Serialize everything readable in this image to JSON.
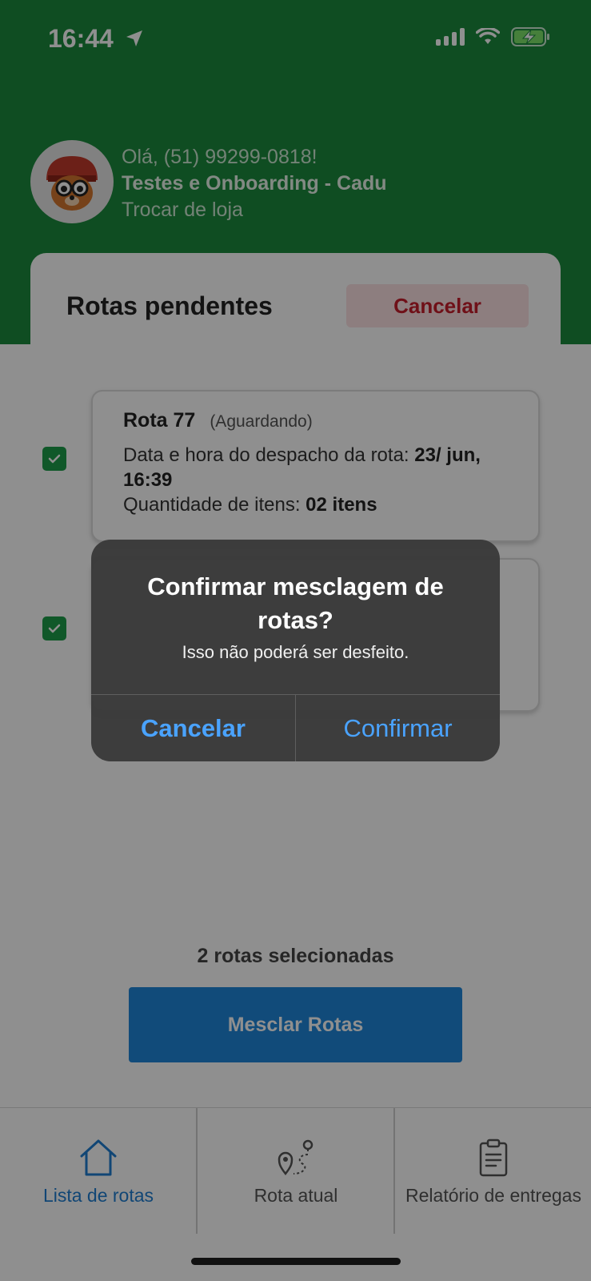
{
  "status_bar": {
    "time": "16:44"
  },
  "header": {
    "greeting": "Olá, (51) 99299-0818!",
    "store_name": "Testes e Onboarding - Cadu",
    "switch_store": "Trocar de loja"
  },
  "panel": {
    "title": "Rotas pendentes",
    "cancel_label": "Cancelar"
  },
  "routes": [
    {
      "name": "Rota 77",
      "status": "(Aguardando)",
      "dispatch_label": "Data e hora do despacho da rota:",
      "dispatch_value": "23/ jun, 16:39",
      "items_label": "Quantidade de itens:",
      "items_value": "02 itens",
      "selected": true
    },
    {
      "selected": true
    }
  ],
  "selection": {
    "count_text": "2 rotas selecionadas",
    "merge_label": "Mesclar Rotas"
  },
  "tabbar": {
    "tabs": [
      {
        "label": "Lista de rotas",
        "icon": "home-icon",
        "active": true
      },
      {
        "label": "Rota atual",
        "icon": "route-map-icon",
        "active": false
      },
      {
        "label": "Relatório de entregas",
        "icon": "clipboard-icon",
        "active": false
      }
    ]
  },
  "alert": {
    "title": "Confirmar mesclagem de rotas?",
    "message": "Isso não poderá ser desfeito.",
    "cancel_label": "Cancelar",
    "confirm_label": "Confirmar"
  },
  "colors": {
    "header_green": "#1b8a3d",
    "primary_blue": "#1f86d9",
    "danger_red": "#c71d2c",
    "alert_link": "#4aa3ff"
  }
}
